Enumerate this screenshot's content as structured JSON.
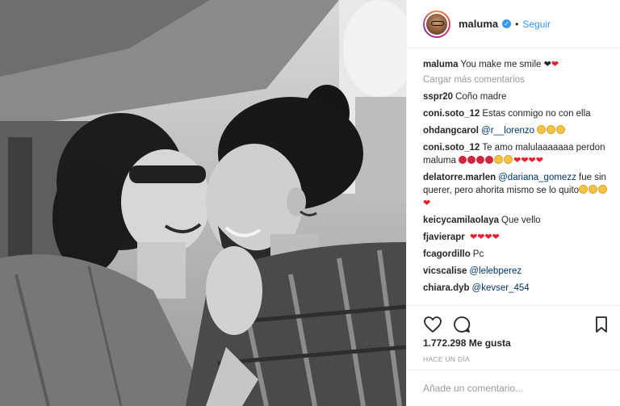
{
  "post": {
    "username": "maluma",
    "separator": "•",
    "follow_label": "Seguir",
    "caption": {
      "user": "maluma",
      "text": "You make me smile"
    },
    "load_more_label": "Cargar más comentarios",
    "comments": [
      {
        "user": "sspr20",
        "text": "Coño madre"
      },
      {
        "user": "coni.soto_12",
        "text": "Estas conmigo no con ella"
      },
      {
        "user": "ohdangcarol",
        "mention": "@r__lorenzo"
      },
      {
        "user": "coni.soto_12",
        "text": "Te amo malulaaaaaaa perdon maluma"
      },
      {
        "user": "delatorre.marlen",
        "mention": "@dariana_gomezz",
        "text": "fue sin querer, pero ahorita mismo se lo quito"
      },
      {
        "user": "keicycamilaolaya",
        "text": "Que vello"
      },
      {
        "user": "fjavierapr",
        "text": ""
      },
      {
        "user": "fcagordillo",
        "text": "Pc"
      },
      {
        "user": "vicscalise",
        "mention": "@lelebperez"
      },
      {
        "user": "chiara.dyb",
        "mention": "@kevser_454"
      }
    ],
    "likes": "1.772.298 Me gusta",
    "time": "HACE UN DÍA",
    "add_comment_placeholder": "Añade un comentario..."
  },
  "icons": [
    "heart-outline-icon",
    "comment-icon",
    "bookmark-icon",
    "verified-badge-icon"
  ],
  "colors": {
    "link": "#3897f0",
    "mention": "#003569",
    "muted": "#999999",
    "text": "#262626",
    "heart": "#ed1c2e"
  }
}
